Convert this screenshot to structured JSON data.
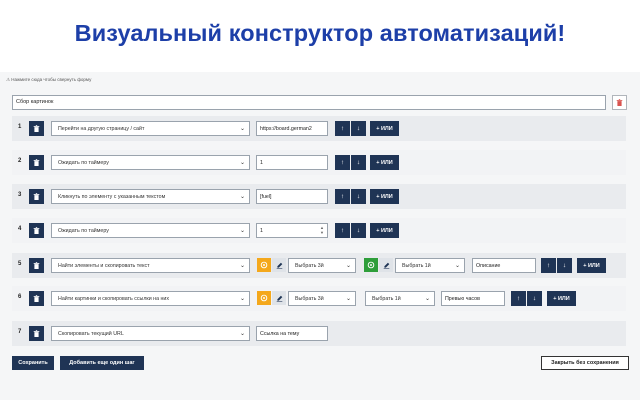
{
  "headline": "Визуальный конструктор автоматизаций!",
  "hint": "⚠ Нажмите сюда чтобы свернуть форму",
  "form": {
    "name_value": "Сбор картинок"
  },
  "steps": [
    {
      "num": "1",
      "action": "Перейти на другую страницу / сайт",
      "value": "https://board.german2",
      "or_label": "+ ИЛИ"
    },
    {
      "num": "2",
      "action": "Ожидать по таймеру",
      "value": "1",
      "or_label": "+ ИЛИ"
    },
    {
      "num": "3",
      "action": "Кликнуть по элементу с указанным текстом",
      "value": "[fuel]",
      "or_label": "+ ИЛИ"
    },
    {
      "num": "4",
      "action": "Ожидать по таймеру",
      "value": "1",
      "or_label": "+ ИЛИ"
    },
    {
      "num": "5",
      "action": "Найти элементы и скопировать текст",
      "select_a": "Выбрать 3й",
      "select_b": "Выбрать 1й",
      "value": "Описание",
      "or_label": "+ ИЛИ"
    },
    {
      "num": "6",
      "action": "Найти картинки и скопировать ссылки на них",
      "select_a": "Выбрать 3й",
      "select_b": "Выбрать 1й",
      "value": "Превью часов",
      "or_label": "+ ИЛИ"
    },
    {
      "num": "7",
      "action": "Скопировать текущий URL",
      "value": "Ссылка на тему"
    }
  ],
  "footer": {
    "save": "Сохранить",
    "add_step": "Добавить еще один шаг",
    "close": "Закрыть без сохранения"
  },
  "colors": {
    "accent_dark": "#1f3455",
    "headline": "#1d3fa8",
    "orange": "#f4a81c",
    "green": "#2e9e3a",
    "delete_red": "#d9534f"
  },
  "icons": {
    "delete": "trash-icon",
    "up": "arrow-up-icon",
    "down": "arrow-down-icon",
    "target": "target-icon",
    "edit": "edit-icon",
    "chevron": "chevron-down-icon"
  }
}
